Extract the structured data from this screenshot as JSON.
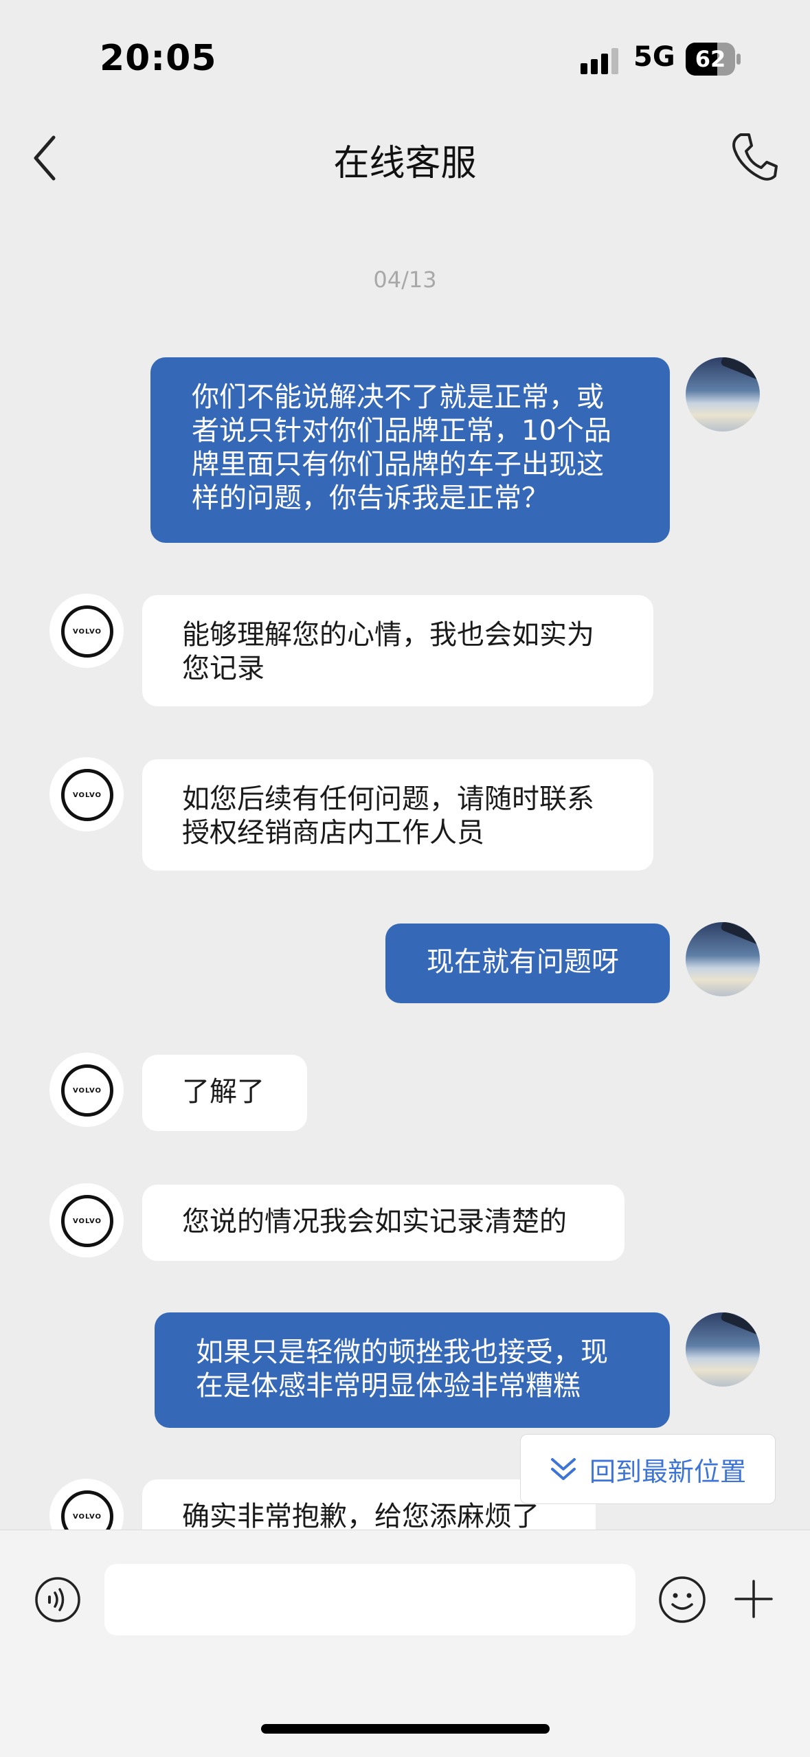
{
  "status_bar": {
    "time": "20:05",
    "network": "5G",
    "battery": "62"
  },
  "header": {
    "title": "在线客服",
    "back_icon": "chevron-left-icon",
    "call_icon": "phone-icon"
  },
  "date_separator": "04/13",
  "bot_logo_text": "VOLVO",
  "messages": [
    {
      "sender": "user",
      "text": "你们不能说解决不了就是正常，或者说只针对你们品牌正常，10个品牌里面只有你们品牌的车子出现这样的问题，你告诉我是正常？"
    },
    {
      "sender": "bot",
      "text": "能够理解您的心情，我也会如实为您记录"
    },
    {
      "sender": "bot",
      "text": "如您后续有任何问题，请随时联系授权经销商店内工作人员"
    },
    {
      "sender": "user",
      "text": "现在就有问题呀"
    },
    {
      "sender": "bot",
      "text": "了解了"
    },
    {
      "sender": "bot",
      "text": "您说的情况我会如实记录清楚的"
    },
    {
      "sender": "user",
      "text": "如果只是轻微的顿挫我也接受，现在是体感非常明显体验非常糟糕"
    },
    {
      "sender": "bot",
      "text": "确实非常抱歉，给您添麻烦了"
    }
  ],
  "jump_button": {
    "label": "回到最新位置",
    "icon": "double-chevron-down-icon"
  },
  "input_bar": {
    "placeholder": "",
    "voice_icon": "voice-icon",
    "emoji_icon": "emoji-icon",
    "plus_icon": "plus-icon"
  },
  "colors": {
    "user_bubble": "#3568b6",
    "bot_bubble": "#ffffff",
    "background": "#ededed",
    "accent": "#3e74d6"
  }
}
